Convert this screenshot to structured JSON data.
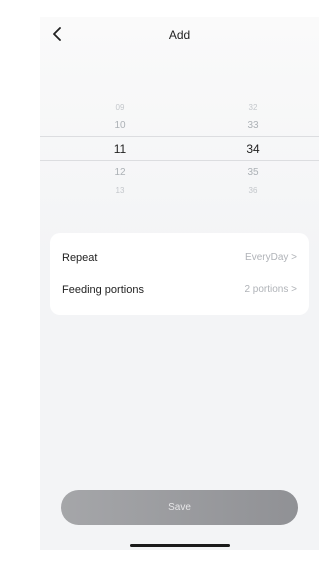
{
  "header": {
    "title": "Add",
    "back_icon": "chevron-left-icon"
  },
  "picker": {
    "hours": {
      "values": [
        "",
        "09",
        "10",
        "11",
        "12",
        "13",
        ""
      ],
      "selected": "11"
    },
    "minutes": {
      "values": [
        "",
        "32",
        "33",
        "34",
        "35",
        "36",
        ""
      ],
      "selected": "34"
    }
  },
  "settings": {
    "repeat": {
      "label": "Repeat",
      "value": "EveryDay >"
    },
    "portions": {
      "label": "Feeding portions",
      "value": "2 portions >"
    }
  },
  "footer": {
    "save_label": "Save"
  },
  "colors": {
    "save_button": "#9b9c9f",
    "background": "#f3f4f6",
    "card": "#ffffff"
  }
}
